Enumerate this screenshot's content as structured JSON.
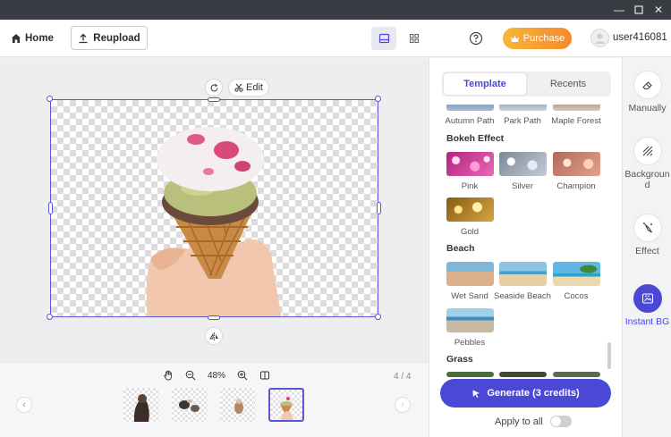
{
  "toolbar": {
    "home_label": "Home",
    "reupload_label": "Reupload",
    "purchase_label": "Purchase",
    "username": "user416081"
  },
  "canvas": {
    "edit_label": "Edit",
    "zoom_level": "48%",
    "page_count": "4 / 4"
  },
  "panel": {
    "tabs": [
      {
        "label": "Template",
        "active": true
      },
      {
        "label": "Recents",
        "active": false
      }
    ],
    "partial_row": [
      "Autumn Path",
      "Park Path",
      "Maple Forest"
    ],
    "categories": [
      {
        "title": "Bokeh Effect",
        "items": [
          "Pink",
          "Silver",
          "Champion",
          "Gold"
        ]
      },
      {
        "title": "Beach",
        "items": [
          "Wet Sand",
          "Seaside Beach",
          "Cocos",
          "Pebbles"
        ]
      },
      {
        "title": "Grass",
        "items": []
      }
    ],
    "generate_label": "Generate (3 credits)",
    "apply_all_label": "Apply to all",
    "apply_all_on": false
  },
  "rail": {
    "items": [
      {
        "label": "Manually",
        "icon": "eraser-icon",
        "active": false
      },
      {
        "label": "Background",
        "icon": "hatch-icon",
        "active": false
      },
      {
        "label": "Effect",
        "icon": "magic-wand-icon",
        "active": false
      },
      {
        "label": "Instant BG",
        "icon": "instant-bg-icon",
        "active": true
      }
    ]
  },
  "colors": {
    "accent": "#4b48d6",
    "purchase_start": "#f7b53b",
    "purchase_end": "#f48a2a",
    "titlebar": "#3a3c44"
  }
}
